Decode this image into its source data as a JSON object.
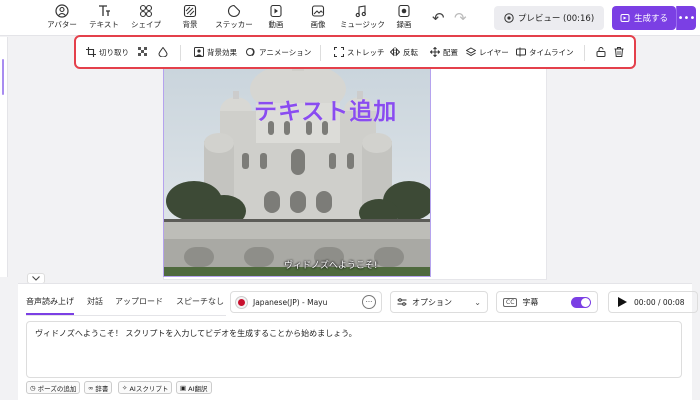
{
  "toolbar": {
    "tools": [
      "アバター",
      "テキスト",
      "シェイプ",
      "背景",
      "ステッカー",
      "動画",
      "画像",
      "ミュージック",
      "録画"
    ],
    "preview_label": "プレビュー (00:16)",
    "generate_label": "生成する",
    "more_label": "•••"
  },
  "edit_toolbar": {
    "crop": "切り取り",
    "bg_effect": "背景効果",
    "animation": "アニメーション",
    "stretch": "ストレッチ",
    "flip": "反転",
    "arrange": "配置",
    "layer": "レイヤー",
    "timeline": "タイムライン"
  },
  "canvas": {
    "title_text": "テキスト追加",
    "subtitle_text": "ヴィドノズへようこそ!"
  },
  "panel": {
    "tabs": [
      "音声読み上げ",
      "対話",
      "アップロード",
      "スピーチなし"
    ],
    "voice": "Japanese(JP) - Mayu",
    "voice_more": "···",
    "options": "オプション",
    "subtitles": "字幕",
    "cc": "CC",
    "time": "00:00 / 00:08",
    "script": "ヴィドノズへようこそ！ スクリプトを入力してビデオを生成することから始めましょう。",
    "chips": [
      "ポーズの追加",
      "辞書",
      "AIスクリプト",
      "AI翻訳"
    ]
  },
  "colors": {
    "accent": "#7b3fe4",
    "highlight": "#e4404b"
  }
}
